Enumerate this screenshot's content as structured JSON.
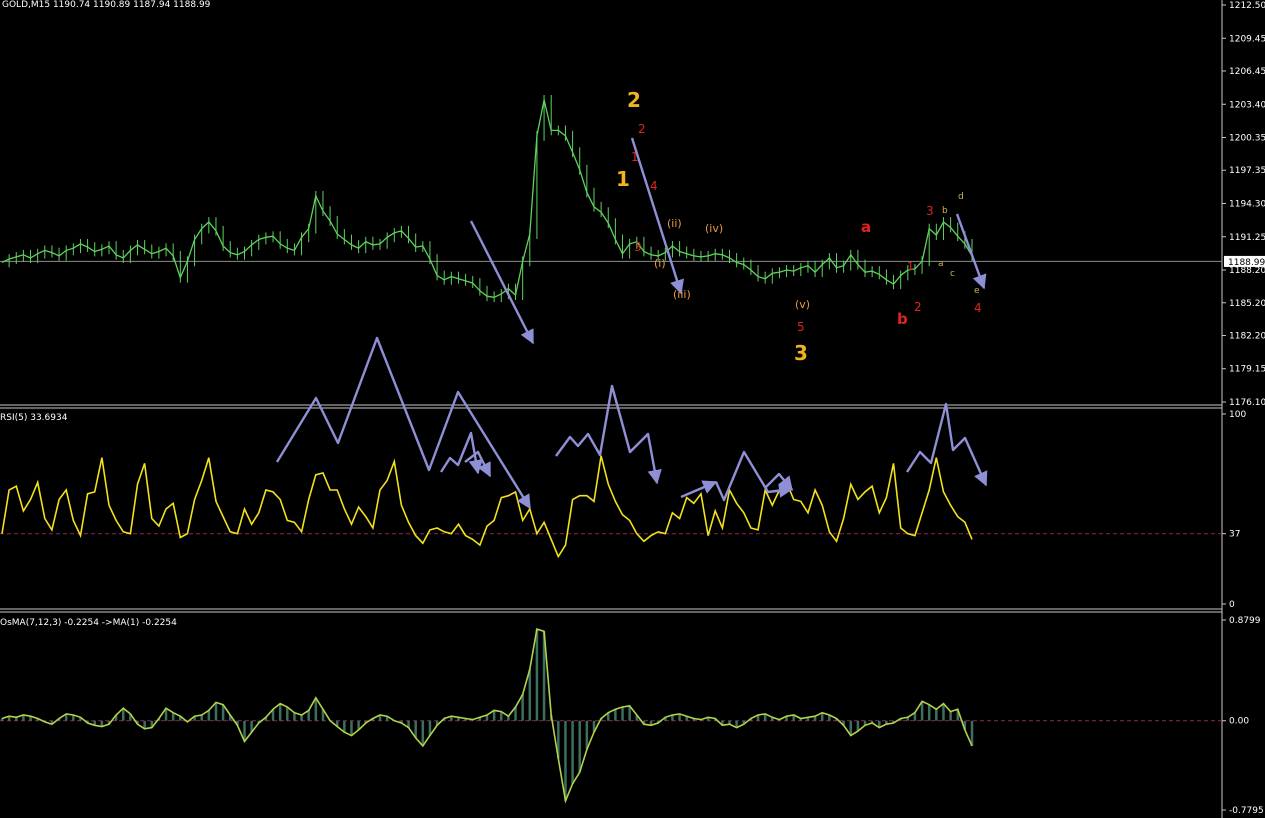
{
  "colors": {
    "background": "#000000",
    "price_line": "#5ED35E",
    "rsi_line": "#F2E21A",
    "osma_line": "#B2D34A",
    "osma_hist": "#3E6E5E",
    "separator": "#C8C8C8",
    "arrow": "#8F8FD6",
    "level_dash": "#8A2B53",
    "label_orange": "#F0B41E",
    "label_red": "#E0241E",
    "label_olive": "#C8B45A",
    "label_light_orange": "#E69A46"
  },
  "panes": {
    "price": {
      "header": "GOLD,M15  1190.74 1190.89 1187.94 1188.99",
      "ticks": [
        "1212.50",
        "1209.45",
        "1206.45",
        "1203.40",
        "1200.35",
        "1197.35",
        "1194.30",
        "1191.25",
        "1188.20",
        "1185.20",
        "1182.20",
        "1179.15",
        "1176.10"
      ],
      "current_price": "1188.99"
    },
    "rsi": {
      "header": "RSI(5) 33.6934",
      "ticks": [
        "100",
        "37",
        "0"
      ],
      "level": "37"
    },
    "osma": {
      "header": "OsMA(7,12,3) -0.2254  ->MA(1) -0.2254",
      "ticks": [
        "0.8799",
        "0.00",
        "-0.7795"
      ]
    }
  },
  "wave_labels": [
    {
      "text": "2",
      "tone": "label_orange"
    },
    {
      "text": "1",
      "tone": "label_orange"
    },
    {
      "text": "3",
      "tone": "label_orange"
    },
    {
      "text": "2",
      "tone": "label_red"
    },
    {
      "text": "1",
      "tone": "label_red"
    },
    {
      "text": "4",
      "tone": "label_red"
    },
    {
      "text": "3",
      "tone": "label_red"
    },
    {
      "text": "5",
      "tone": "label_red"
    },
    {
      "text": "(i)",
      "tone": "label_light_orange"
    },
    {
      "text": "(ii)",
      "tone": "label_light_orange"
    },
    {
      "text": "(iii)",
      "tone": "label_light_orange"
    },
    {
      "text": "(iv)",
      "tone": "label_light_orange"
    },
    {
      "text": "(v)",
      "tone": "label_light_orange"
    },
    {
      "text": "a",
      "tone": "label_red"
    },
    {
      "text": "b",
      "tone": "label_red"
    },
    {
      "text": "1",
      "tone": "label_red"
    },
    {
      "text": "2",
      "tone": "label_red"
    },
    {
      "text": "3",
      "tone": "label_red"
    },
    {
      "text": "4",
      "tone": "label_red"
    },
    {
      "text": "a",
      "tone": "label_olive"
    },
    {
      "text": "b",
      "tone": "label_olive"
    },
    {
      "text": "c",
      "tone": "label_olive"
    },
    {
      "text": "d",
      "tone": "label_olive"
    },
    {
      "text": "e",
      "tone": "label_olive"
    }
  ],
  "chart_data": [
    {
      "type": "line",
      "title": "GOLD,M15",
      "series": [
        {
          "name": "GOLD",
          "values": [
            1188.9,
            1189.2,
            1189.4,
            1189.6,
            1189.3,
            1189.7,
            1190.0,
            1189.8,
            1189.5,
            1190.0,
            1190.2,
            1190.6,
            1190.3,
            1189.9,
            1190.1,
            1190.4,
            1189.6,
            1189.3,
            1190.0,
            1190.5,
            1190.1,
            1189.7,
            1189.9,
            1190.2,
            1189.5,
            1187.5,
            1189.0,
            1191.0,
            1192.0,
            1192.6,
            1191.8,
            1190.4,
            1189.8,
            1189.6,
            1189.9,
            1190.5,
            1191.0,
            1191.2,
            1191.3,
            1190.6,
            1190.2,
            1190.0,
            1191.2,
            1192.0,
            1195.0,
            1193.6,
            1192.7,
            1191.5,
            1191.0,
            1190.5,
            1190.2,
            1190.8,
            1190.5,
            1190.6,
            1191.2,
            1191.6,
            1191.8,
            1191.1,
            1190.3,
            1190.4,
            1189.2,
            1187.7,
            1187.3,
            1187.6,
            1187.4,
            1187.2,
            1187.0,
            1186.3,
            1185.8,
            1185.7,
            1186.0,
            1186.5,
            1185.9,
            1189.0,
            1191.5,
            1200.5,
            1203.8,
            1201.0,
            1201.0,
            1200.5,
            1199.0,
            1197.4,
            1195.3,
            1194.0,
            1193.5,
            1192.5,
            1191.0,
            1189.7,
            1190.6,
            1190.8,
            1189.9,
            1189.6,
            1189.5,
            1189.8,
            1190.4,
            1189.9,
            1189.7,
            1189.5,
            1189.4,
            1189.5,
            1189.7,
            1189.6,
            1189.3,
            1188.9,
            1188.7,
            1188.2,
            1187.6,
            1187.4,
            1187.9,
            1188.0,
            1188.2,
            1188.1,
            1188.4,
            1188.6,
            1188.0,
            1188.7,
            1189.3,
            1188.4,
            1188.6,
            1189.6,
            1188.7,
            1188.0,
            1188.1,
            1187.8,
            1187.3,
            1186.9,
            1187.7,
            1188.2,
            1188.3,
            1189.0,
            1192.0,
            1191.4,
            1192.6,
            1192.1,
            1191.3,
            1190.6,
            1189.5
          ]
        }
      ]
    },
    {
      "type": "line",
      "title": "RSI(5)",
      "ylim": [
        0,
        100
      ],
      "level": 37,
      "series": [
        {
          "name": "RSI(5)",
          "values": [
            37,
            60,
            62,
            49,
            55,
            64,
            45,
            39,
            55,
            60,
            44,
            36,
            58,
            59,
            77,
            52,
            44,
            38,
            37,
            63,
            74,
            45,
            41,
            50,
            53,
            35,
            37,
            55,
            65,
            77,
            54,
            46,
            38,
            37,
            50,
            42,
            48,
            60,
            59,
            55,
            44,
            43,
            38,
            55,
            68,
            69,
            60,
            60,
            50,
            42,
            51,
            46,
            40,
            60,
            65,
            75,
            52,
            43,
            36,
            32,
            39,
            40,
            38,
            37,
            42,
            36,
            34,
            31,
            41,
            44,
            56,
            57,
            59,
            44,
            50,
            37,
            43,
            34,
            25,
            31,
            55,
            57,
            57,
            54,
            78,
            63,
            54,
            47,
            44,
            37,
            33,
            36,
            38,
            37,
            48,
            45,
            56,
            53,
            58,
            36,
            49,
            40,
            60,
            53,
            48,
            40,
            39,
            60,
            52,
            60,
            64,
            55,
            54,
            48,
            60,
            52,
            38,
            33,
            45,
            63,
            55,
            59,
            62,
            48,
            56,
            74,
            40,
            37,
            36,
            48,
            60,
            77,
            59,
            52,
            46,
            43,
            34
          ]
        }
      ]
    },
    {
      "type": "area",
      "title": "OsMA(7,12,3)",
      "ylim": [
        -0.7795,
        0.8799
      ],
      "series": [
        {
          "name": "OsMA(7,12,3)",
          "values": [
            0.02,
            0.04,
            0.03,
            0.05,
            0.04,
            0.02,
            -0.01,
            -0.03,
            0.02,
            0.06,
            0.05,
            0.03,
            -0.02,
            -0.04,
            -0.05,
            -0.03,
            0.05,
            0.11,
            0.06,
            -0.03,
            -0.07,
            -0.06,
            0.02,
            0.11,
            0.07,
            0.04,
            -0.01,
            0.04,
            0.05,
            0.09,
            0.16,
            0.14,
            0.05,
            -0.04,
            -0.18,
            -0.1,
            -0.02,
            0.03,
            0.1,
            0.15,
            0.12,
            0.07,
            0.05,
            0.09,
            0.2,
            0.1,
            0.0,
            -0.05,
            -0.1,
            -0.13,
            -0.08,
            -0.02,
            0.02,
            0.05,
            0.04,
            0.0,
            -0.02,
            -0.06,
            -0.15,
            -0.22,
            -0.13,
            -0.04,
            0.02,
            0.04,
            0.03,
            0.02,
            0.01,
            0.03,
            0.05,
            0.09,
            0.08,
            0.04,
            0.12,
            0.23,
            0.45,
            0.8,
            0.78,
            0.05,
            -0.33,
            -0.7,
            -0.55,
            -0.45,
            -0.25,
            -0.1,
            0.02,
            0.07,
            0.1,
            0.12,
            0.13,
            0.05,
            -0.03,
            -0.04,
            -0.02,
            0.03,
            0.05,
            0.06,
            0.04,
            0.02,
            0.01,
            0.03,
            0.02,
            -0.04,
            -0.03,
            -0.06,
            -0.03,
            0.02,
            0.05,
            0.06,
            0.03,
            0.01,
            0.04,
            0.05,
            0.02,
            0.03,
            0.04,
            0.07,
            0.05,
            0.02,
            -0.04,
            -0.13,
            -0.09,
            -0.04,
            -0.02,
            -0.06,
            -0.03,
            -0.02,
            0.02,
            0.03,
            0.07,
            0.17,
            0.14,
            0.1,
            0.15,
            0.08,
            0.1,
            -0.08,
            -0.22
          ]
        }
      ]
    }
  ]
}
